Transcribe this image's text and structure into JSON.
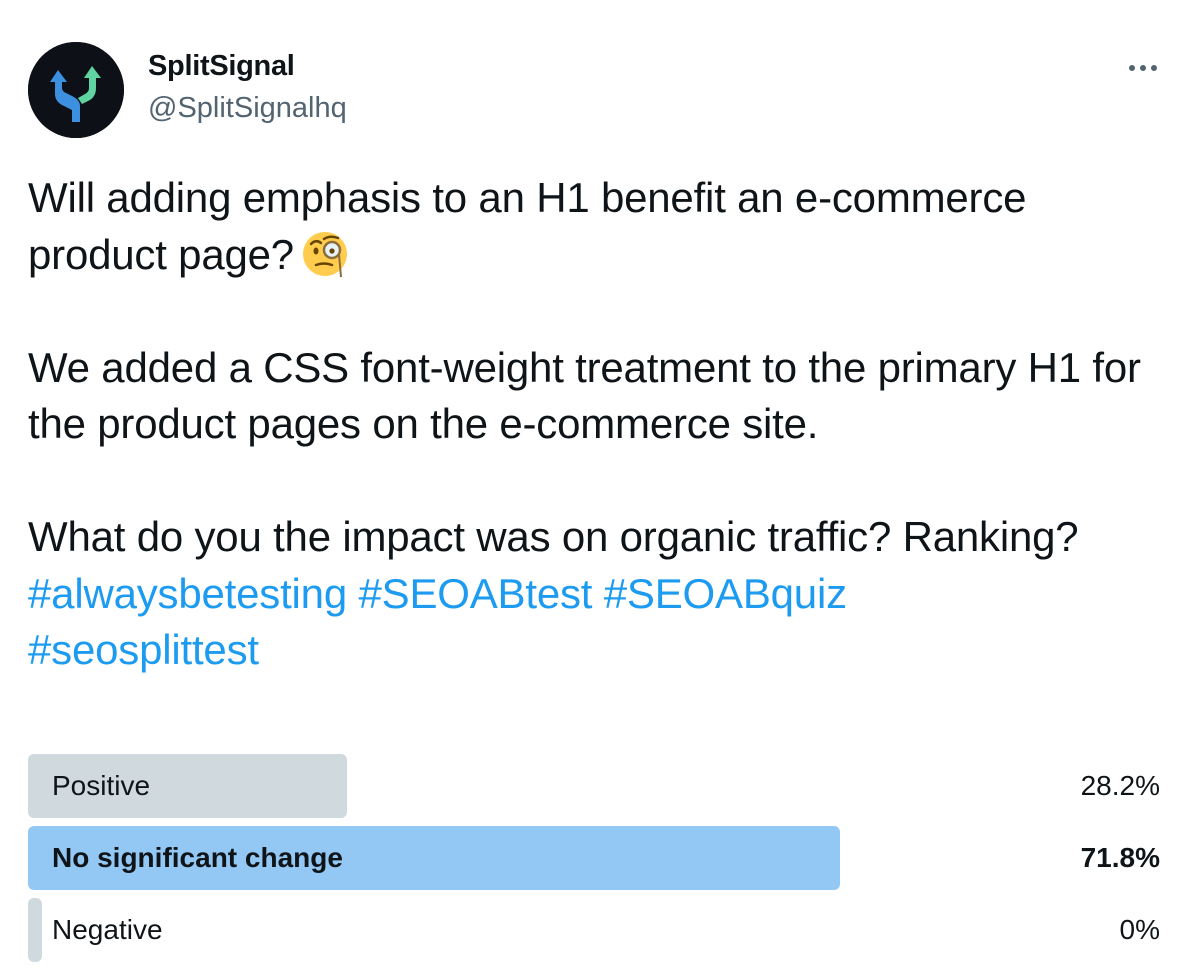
{
  "author": {
    "name": "SplitSignal",
    "handle": "@SplitSignalhq"
  },
  "tweet": {
    "line1": "Will adding emphasis to an H1 benefit an e-commerce product page?",
    "emoji_name": "face-with-monocle-emoji",
    "para2": "We added a CSS font-weight treatment to the primary H1 for the product pages on the e-commerce site.",
    "para3": "What do you the impact was on organic traffic? Ranking?",
    "hashtags": [
      "#alwaysbetesting",
      "#SEOABtest",
      "#SEOABquiz",
      "#seosplittest"
    ]
  },
  "poll": {
    "options": [
      {
        "label": "Positive",
        "percent_text": "28.2%",
        "percent": 28.2,
        "winner": false
      },
      {
        "label": "No significant change",
        "percent_text": "71.8%",
        "percent": 71.8,
        "winner": true
      },
      {
        "label": "Negative",
        "percent_text": "0%",
        "percent": 0,
        "winner": false
      }
    ]
  },
  "icons": {
    "avatar": "split-arrows-logo-icon",
    "more": "more-options-icon"
  },
  "colors": {
    "link": "#1d9bf0",
    "winner_bar": "#93c8f5",
    "bar": "#cfd9de",
    "secondary_text": "#536471"
  }
}
